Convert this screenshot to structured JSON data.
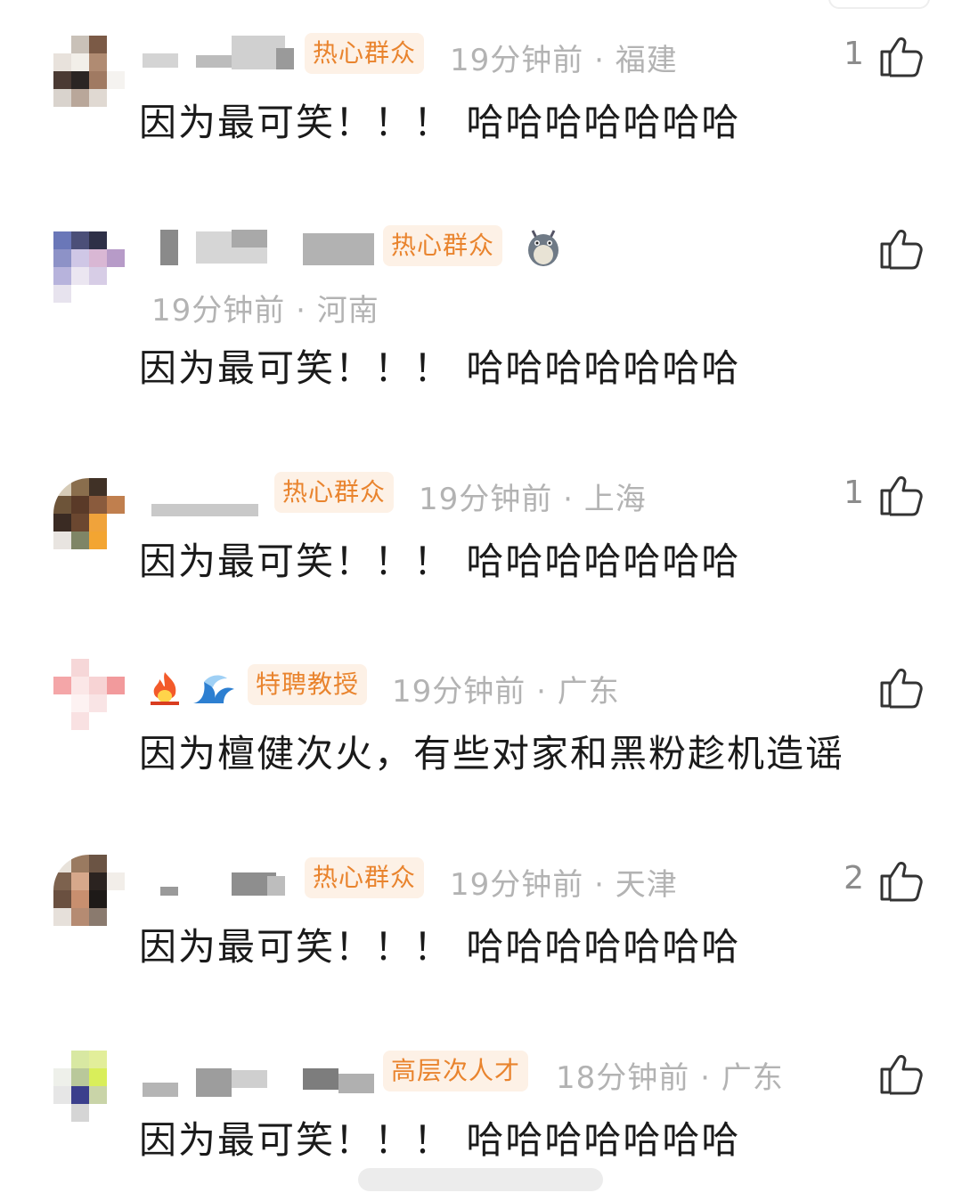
{
  "comments": [
    {
      "badge": "热心群众",
      "time": "19分钟前",
      "location": "福建",
      "text": "因为最可笑！！！ 哈哈哈哈哈哈哈",
      "likes": "1"
    },
    {
      "badge": "热心群众",
      "time": "19分钟前",
      "location": "河南",
      "text": "因为最可笑！！！ 哈哈哈哈哈哈哈",
      "likes": "",
      "extra_icon": "totoro-icon"
    },
    {
      "badge": "热心群众",
      "time": "19分钟前",
      "location": "上海",
      "text": "因为最可笑！！！ 哈哈哈哈哈哈哈",
      "likes": "1"
    },
    {
      "badge": "特聘教授",
      "time": "19分钟前",
      "location": "广东",
      "text": "因为檀健次火，有些对家和黑粉趁机造谣",
      "likes": "",
      "icons": [
        "fire-icon",
        "wave-icon"
      ]
    },
    {
      "badge": "热心群众",
      "time": "19分钟前",
      "location": "天津",
      "text": "因为最可笑！！！ 哈哈哈哈哈哈哈",
      "likes": "2"
    },
    {
      "badge": "高层次人才",
      "time": "18分钟前",
      "location": "广东",
      "text": "因为最可笑！！！ 哈哈哈哈哈哈哈",
      "likes": ""
    }
  ],
  "separator": " · ",
  "icons": {
    "like": "thumbs-up-icon"
  },
  "colors": {
    "badge_text": "#e9842e",
    "badge_bg": "#fdf1e6",
    "meta": "#b3b3b3",
    "body": "#1a1a1a"
  }
}
